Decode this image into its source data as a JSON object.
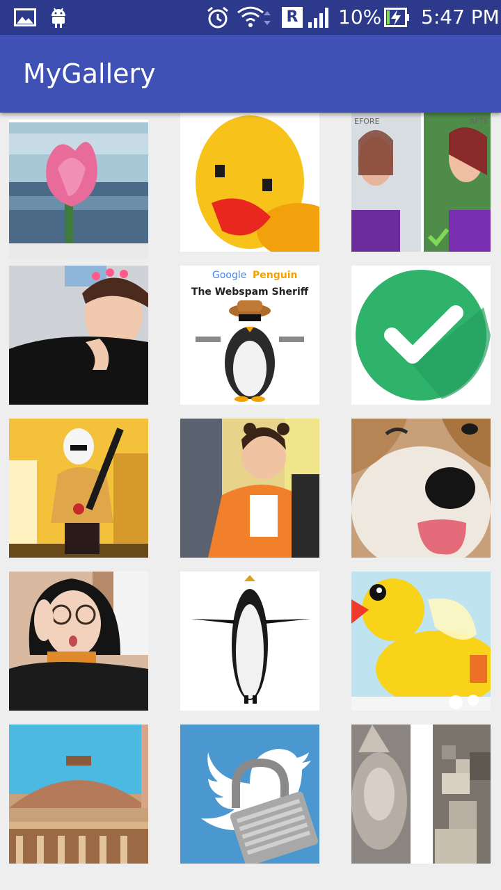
{
  "status_bar": {
    "battery_text": "10%",
    "time": "5:47 PM",
    "roaming_badge": "R",
    "icons": [
      "gallery-notification-icon",
      "android-notification-icon",
      "alarm-icon",
      "wifi-icon",
      "roaming-icon",
      "signal-icon",
      "battery-charging-icon"
    ]
  },
  "app_bar": {
    "title": "MyGallery",
    "color": "#3f51b5",
    "status_color": "#2d3a8c"
  },
  "gallery": {
    "items": [
      {
        "id": "lotus-pixelated"
      },
      {
        "id": "rubber-duck-pixelated"
      },
      {
        "id": "before-after-photo",
        "labels": [
          "EFORE",
          "AFTE"
        ]
      },
      {
        "id": "portrait-flower-crown"
      },
      {
        "id": "google-penguin-sheriff",
        "labels": [
          "Google",
          "Penguin",
          "The Webspam Sheriff"
        ]
      },
      {
        "id": "green-check-icon"
      },
      {
        "id": "stormtrooper-bat"
      },
      {
        "id": "smiling-girl-orange-jacket"
      },
      {
        "id": "dog-closeup"
      },
      {
        "id": "girl-glasses-phone"
      },
      {
        "id": "penguin-3d"
      },
      {
        "id": "rubber-duck-bubbles"
      },
      {
        "id": "stupa-dome"
      },
      {
        "id": "twitter-padlock"
      },
      {
        "id": "cat-pixelated"
      }
    ]
  }
}
